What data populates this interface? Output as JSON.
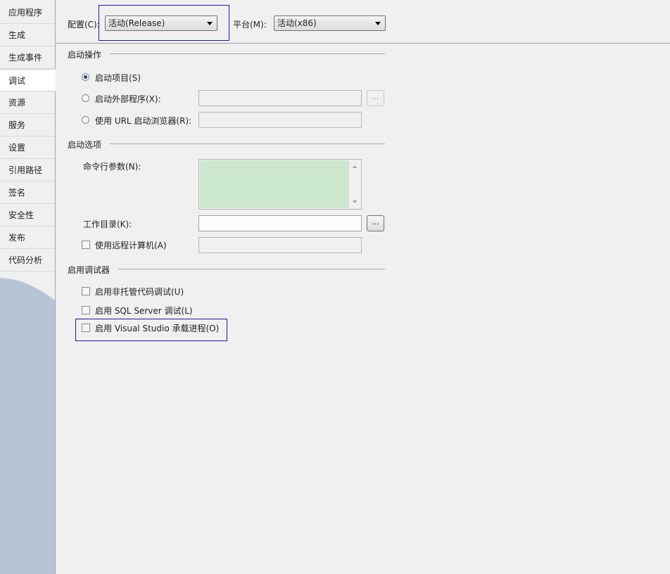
{
  "sidebar": {
    "tabs": [
      {
        "label": "应用程序"
      },
      {
        "label": "生成"
      },
      {
        "label": "生成事件"
      },
      {
        "label": "调试",
        "active": true
      },
      {
        "label": "资源"
      },
      {
        "label": "服务"
      },
      {
        "label": "设置"
      },
      {
        "label": "引用路径"
      },
      {
        "label": "签名"
      },
      {
        "label": "安全性"
      },
      {
        "label": "发布"
      },
      {
        "label": "代码分析"
      }
    ]
  },
  "header": {
    "config_label": "配置(C):",
    "config_value": "活动(Release)",
    "platform_label": "平台(M):",
    "platform_value": "活动(x86)"
  },
  "start_action": {
    "title": "启动操作",
    "start_project": "启动项目(S)",
    "start_external": "启动外部程序(X):",
    "start_browser": "使用 URL 启动浏览器(R):",
    "browse": "..."
  },
  "start_options": {
    "title": "启动选项",
    "cmd_args": "命令行参数(N):",
    "work_dir": "工作目录(K):",
    "remote_machine": "使用远程计算机(A)",
    "browse": "..."
  },
  "debuggers": {
    "title": "启用调试器",
    "unmanaged": "启用非托管代码调试(U)",
    "sql": "启用 SQL Server 调试(L)",
    "vshost": "启用 Visual Studio 承载进程(O)"
  },
  "colors": {
    "highlight_border": "#1a1aa0",
    "cmd_args_fill": "#cce8cf",
    "sidebar_bg": "#b9c3d6"
  }
}
